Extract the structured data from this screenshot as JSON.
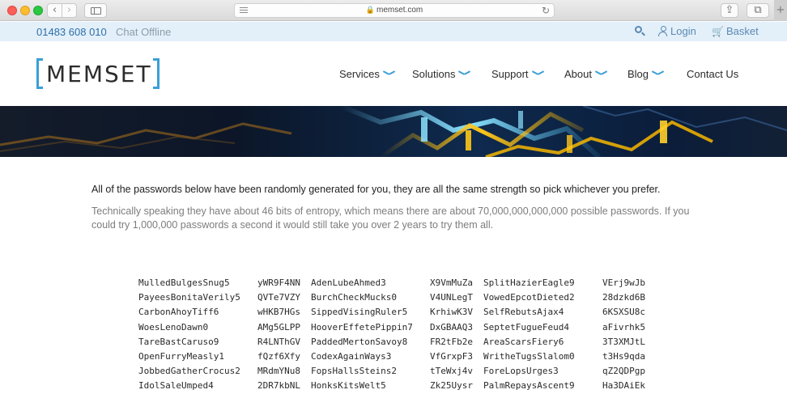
{
  "browser": {
    "url": "memset.com",
    "back_glyph": "‹",
    "forward_glyph": "›",
    "reload_glyph": "↻",
    "share_glyph": "⇪",
    "tabs_glyph": "⧉",
    "new_tab_glyph": "+"
  },
  "utility_bar": {
    "phone": "01483 608 010",
    "chat_status": "Chat Offline",
    "login_label": "Login",
    "basket_label": "Basket",
    "basket_glyph": "🛒"
  },
  "header": {
    "logo_text": "MEMSET",
    "nav": [
      "Services",
      "Solutions",
      "Support",
      "About",
      "Blog",
      "Contact Us"
    ]
  },
  "colors": {
    "accent": "#3a9fd8",
    "link": "#2f6ea9",
    "utility_bg": "#e3f0fa"
  },
  "content": {
    "lead": "All of the passwords below have been randomly generated for you, they are all the same strength so pick whichever you prefer.",
    "sub": "Technically speaking they have about 46 bits of entropy, which means there are about 70,000,000,000,000 possible passwords. If you could try 1,000,000 passwords a second it would still take you over 2 years to try them all."
  },
  "passwords": [
    [
      "MulledBulgesSnug5",
      "yWR9F4NN",
      "AdenLubeAhmed3",
      "X9VmMuZa",
      "SplitHazierEagle9",
      "VErj9wJb"
    ],
    [
      "PayeesBonitaVerily5",
      "QVTe7VZY",
      "BurchCheckMucks0",
      "V4UNLegT",
      "VowedEpcotDieted2",
      "28dzkd6B"
    ],
    [
      "CarbonAhoyTiff6",
      "wHKB7HGs",
      "SippedVisingRuler5",
      "KrhiwK3V",
      "SelfRebutsAjax4",
      "6KSXSU8c"
    ],
    [
      "WoesLenoDawn0",
      "AMg5GLPP",
      "HooverEffetePippin7",
      "DxGBAAQ3",
      "SeptetFugueFeud4",
      "aFivrhk5"
    ],
    [
      "TareBastCaruso9",
      "R4LNThGV",
      "PaddedMertonSavoy8",
      "FR2tFb2e",
      "AreaScarsFiery6",
      "3T3XMJtL"
    ],
    [
      "OpenFurryMeasly1",
      "fQzf6Xfy",
      "CodexAgainWays3",
      "VfGrxpF3",
      "WritheTugsSlalom0",
      "t3Hs9qda"
    ],
    [
      "JobbedGatherCrocus2",
      "MRdmYNu8",
      "FopsHallsSteins2",
      "tTeWxj4v",
      "ForeLopsUrges3",
      "qZ2QDPgp"
    ],
    [
      "IdolSaleUmped4",
      "2DR7kbNL",
      "HonksKitsWelt5",
      "Zk25Uysr",
      "PalmRepaysAscent9",
      "Ha3DAiEk"
    ]
  ]
}
